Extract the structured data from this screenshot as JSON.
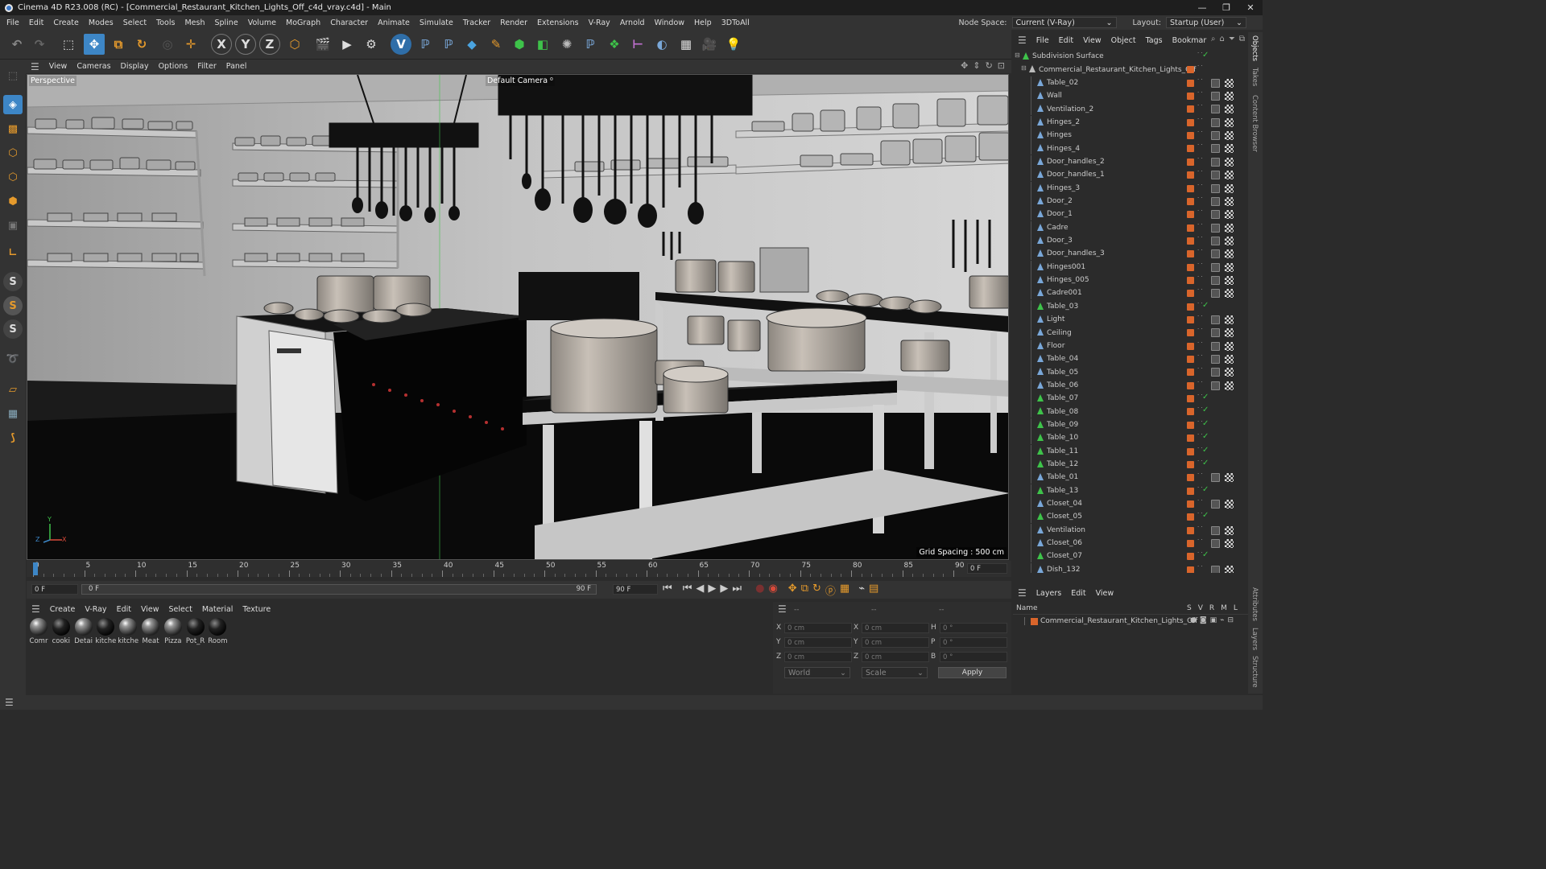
{
  "window": {
    "title": "Cinema 4D R23.008 (RC) - [Commercial_Restaurant_Kitchen_Lights_Off_c4d_vray.c4d] - Main",
    "minimize": "—",
    "maximize": "❐",
    "close": "✕"
  },
  "menubar": {
    "items": [
      "File",
      "Edit",
      "Create",
      "Modes",
      "Select",
      "Tools",
      "Mesh",
      "Spline",
      "Volume",
      "MoGraph",
      "Character",
      "Animate",
      "Simulate",
      "Tracker",
      "Render",
      "Extensions",
      "V-Ray",
      "Arnold",
      "Window",
      "Help",
      "3DToAll"
    ],
    "node_space_label": "Node Space:",
    "node_space_value": "Current (V-Ray)",
    "layout_label": "Layout:",
    "layout_value": "Startup (User)"
  },
  "viewport": {
    "menu": [
      "View",
      "Cameras",
      "Display",
      "Options",
      "Filter",
      "Panel"
    ],
    "projection": "Perspective",
    "camera": "Default Camera",
    "camera_icon": "⁰",
    "grid_spacing": "Grid Spacing : 500 cm",
    "axes": {
      "y": "Y",
      "z": "Z",
      "x": "X"
    }
  },
  "timeline": {
    "ticks": [
      "0",
      "5",
      "10",
      "15",
      "20",
      "25",
      "30",
      "35",
      "40",
      "45",
      "50",
      "55",
      "60",
      "65",
      "70",
      "75",
      "80",
      "85",
      "90"
    ],
    "current_frame_field": "0 F",
    "start_field": "0 F",
    "range_start": "0 F",
    "range_end": "90 F",
    "end_field": "90 F"
  },
  "material_manager": {
    "menu": [
      "Create",
      "V-Ray",
      "Edit",
      "View",
      "Select",
      "Material",
      "Texture"
    ],
    "materials": [
      "Comr",
      "cooki",
      "Detai",
      "kitche",
      "kitche",
      "Meat",
      "Pizza",
      "Pot_R",
      "Room"
    ]
  },
  "coordinates": {
    "header_left": "--",
    "header_mid": "--",
    "header_right": "--",
    "rows": [
      {
        "l1": "X",
        "v1": "0 cm",
        "l2": "X",
        "v2": "0 cm",
        "l3": "H",
        "v3": "0 °"
      },
      {
        "l1": "Y",
        "v1": "0 cm",
        "l2": "Y",
        "v2": "0 cm",
        "l3": "P",
        "v3": "0 °"
      },
      {
        "l1": "Z",
        "v1": "0 cm",
        "l2": "Z",
        "v2": "0 cm",
        "l3": "B",
        "v3": "0 °"
      }
    ],
    "world_dropdown": "World",
    "scale_dropdown": "Scale",
    "apply": "Apply"
  },
  "object_manager": {
    "menu": [
      "File",
      "Edit",
      "View",
      "Object",
      "Tags",
      "Bookmar"
    ],
    "objects": [
      {
        "name": "Subdivision Surface",
        "level": 0,
        "type": "subdiv",
        "check": true,
        "tags": 0
      },
      {
        "name": "Commercial_Restaurant_Kitchen_Lights_Off",
        "level": 1,
        "type": "null",
        "check": false,
        "tags": 0
      },
      {
        "name": "Table_02",
        "level": 2,
        "type": "poly",
        "check": false,
        "tags": 2
      },
      {
        "name": "Wall",
        "level": 2,
        "type": "poly",
        "check": false,
        "tags": 2
      },
      {
        "name": "Ventilation_2",
        "level": 2,
        "type": "poly",
        "check": false,
        "tags": 2
      },
      {
        "name": "Hinges_2",
        "level": 2,
        "type": "poly",
        "check": false,
        "tags": 2
      },
      {
        "name": "Hinges",
        "level": 2,
        "type": "poly",
        "check": false,
        "tags": 2
      },
      {
        "name": "Hinges_4",
        "level": 2,
        "type": "poly",
        "check": false,
        "tags": 2
      },
      {
        "name": "Door_handles_2",
        "level": 2,
        "type": "poly",
        "check": false,
        "tags": 2
      },
      {
        "name": "Door_handles_1",
        "level": 2,
        "type": "poly",
        "check": false,
        "tags": 2
      },
      {
        "name": "Hinges_3",
        "level": 2,
        "type": "poly",
        "check": false,
        "tags": 2
      },
      {
        "name": "Door_2",
        "level": 2,
        "type": "poly",
        "check": false,
        "tags": 2
      },
      {
        "name": "Door_1",
        "level": 2,
        "type": "poly",
        "check": false,
        "tags": 2
      },
      {
        "name": "Cadre",
        "level": 2,
        "type": "poly",
        "check": false,
        "tags": 2
      },
      {
        "name": "Door_3",
        "level": 2,
        "type": "poly",
        "check": false,
        "tags": 2
      },
      {
        "name": "Door_handles_3",
        "level": 2,
        "type": "poly",
        "check": false,
        "tags": 2
      },
      {
        "name": "Hinges001",
        "level": 2,
        "type": "poly",
        "check": false,
        "tags": 2
      },
      {
        "name": "Hinges_005",
        "level": 2,
        "type": "poly",
        "check": false,
        "tags": 2
      },
      {
        "name": "Cadre001",
        "level": 2,
        "type": "poly",
        "check": false,
        "tags": 2
      },
      {
        "name": "Table_03",
        "level": 2,
        "type": "group",
        "check": true,
        "tags": 0
      },
      {
        "name": "Light",
        "level": 2,
        "type": "poly",
        "check": false,
        "tags": 2
      },
      {
        "name": "Ceiling",
        "level": 2,
        "type": "poly",
        "check": false,
        "tags": 2
      },
      {
        "name": "Floor",
        "level": 2,
        "type": "poly",
        "check": false,
        "tags": 2
      },
      {
        "name": "Table_04",
        "level": 2,
        "type": "poly",
        "check": false,
        "tags": 2
      },
      {
        "name": "Table_05",
        "level": 2,
        "type": "poly",
        "check": false,
        "tags": 2
      },
      {
        "name": "Table_06",
        "level": 2,
        "type": "poly",
        "check": false,
        "tags": 2
      },
      {
        "name": "Table_07",
        "level": 2,
        "type": "group",
        "check": true,
        "tags": 0
      },
      {
        "name": "Table_08",
        "level": 2,
        "type": "group",
        "check": true,
        "tags": 0
      },
      {
        "name": "Table_09",
        "level": 2,
        "type": "group",
        "check": true,
        "tags": 0
      },
      {
        "name": "Table_10",
        "level": 2,
        "type": "group",
        "check": true,
        "tags": 0
      },
      {
        "name": "Table_11",
        "level": 2,
        "type": "group",
        "check": true,
        "tags": 0
      },
      {
        "name": "Table_12",
        "level": 2,
        "type": "group",
        "check": true,
        "tags": 0
      },
      {
        "name": "Table_01",
        "level": 2,
        "type": "poly",
        "check": false,
        "tags": 2
      },
      {
        "name": "Table_13",
        "level": 2,
        "type": "group",
        "check": true,
        "tags": 0
      },
      {
        "name": "Closet_04",
        "level": 2,
        "type": "poly",
        "check": false,
        "tags": 2
      },
      {
        "name": "Closet_05",
        "level": 2,
        "type": "group",
        "check": true,
        "tags": 0
      },
      {
        "name": "Ventilation",
        "level": 2,
        "type": "poly",
        "check": false,
        "tags": 2
      },
      {
        "name": "Closet_06",
        "level": 2,
        "type": "poly",
        "check": false,
        "tags": 2
      },
      {
        "name": "Closet_07",
        "level": 2,
        "type": "group",
        "check": true,
        "tags": 0
      },
      {
        "name": "Dish_132",
        "level": 2,
        "type": "poly",
        "check": false,
        "tags": 2
      }
    ]
  },
  "layers": {
    "menu": [
      "Layers",
      "Edit",
      "View"
    ],
    "col_name": "Name",
    "cols": [
      "S",
      "V",
      "R",
      "M",
      "L"
    ],
    "rows": [
      {
        "name": "Commercial_Restaurant_Kitchen_Lights_Off",
        "color": "#d9652b"
      }
    ]
  },
  "right_tabs": [
    "Objects",
    "Takes",
    "Content Browser",
    "Attributes",
    "Layers",
    "Structure"
  ],
  "colors": {
    "accent": "#d9652b",
    "check": "#3ec34a",
    "selection": "#3d86c6"
  }
}
